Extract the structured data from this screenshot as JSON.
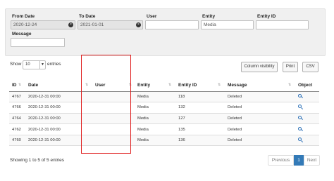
{
  "filters": {
    "from_date": {
      "label": "From Date",
      "value": "2020-12-24"
    },
    "to_date": {
      "label": "To Date",
      "value": "2021-01-01"
    },
    "user": {
      "label": "User",
      "value": ""
    },
    "entity": {
      "label": "Entity",
      "value": "Media"
    },
    "entity_id": {
      "label": "Entity ID",
      "value": ""
    },
    "message": {
      "label": "Message",
      "value": ""
    },
    "clear_glyph": "×"
  },
  "length": {
    "show_label": "Show",
    "value": "10",
    "entries_label": "entries"
  },
  "toolbar": {
    "column_visibility": "Column visibility",
    "print": "Print",
    "csv": "CSV"
  },
  "table": {
    "columns": [
      "ID",
      "Date",
      "User",
      "Entity",
      "Entity ID",
      "Message",
      "Object"
    ],
    "sort_glyph": "⇅",
    "rows": [
      {
        "id": "4767",
        "date": "2020-12-31 00:00",
        "user": "",
        "entity": "Media",
        "entity_id": "118",
        "message": "Deleted"
      },
      {
        "id": "4766",
        "date": "2020-12-31 00:00",
        "user": "",
        "entity": "Media",
        "entity_id": "132",
        "message": "Deleted"
      },
      {
        "id": "4764",
        "date": "2020-12-31 00:00",
        "user": "",
        "entity": "Media",
        "entity_id": "127",
        "message": "Deleted"
      },
      {
        "id": "4762",
        "date": "2020-12-31 00:00",
        "user": "",
        "entity": "Media",
        "entity_id": "135",
        "message": "Deleted"
      },
      {
        "id": "4760",
        "date": "2020-12-31 00:00",
        "user": "",
        "entity": "Media",
        "entity_id": "136",
        "message": "Deleted"
      }
    ],
    "object_icon": "search-icon"
  },
  "footer": {
    "info": "Showing 1 to 5 of 5 entries"
  },
  "pagination": {
    "previous": "Previous",
    "current": "1",
    "next": "Next"
  },
  "colors": {
    "highlight": "#e01f1f",
    "link_blue": "#2a6fb7",
    "active_page": "#337ab7",
    "panel_bg": "#f0f0f0"
  }
}
